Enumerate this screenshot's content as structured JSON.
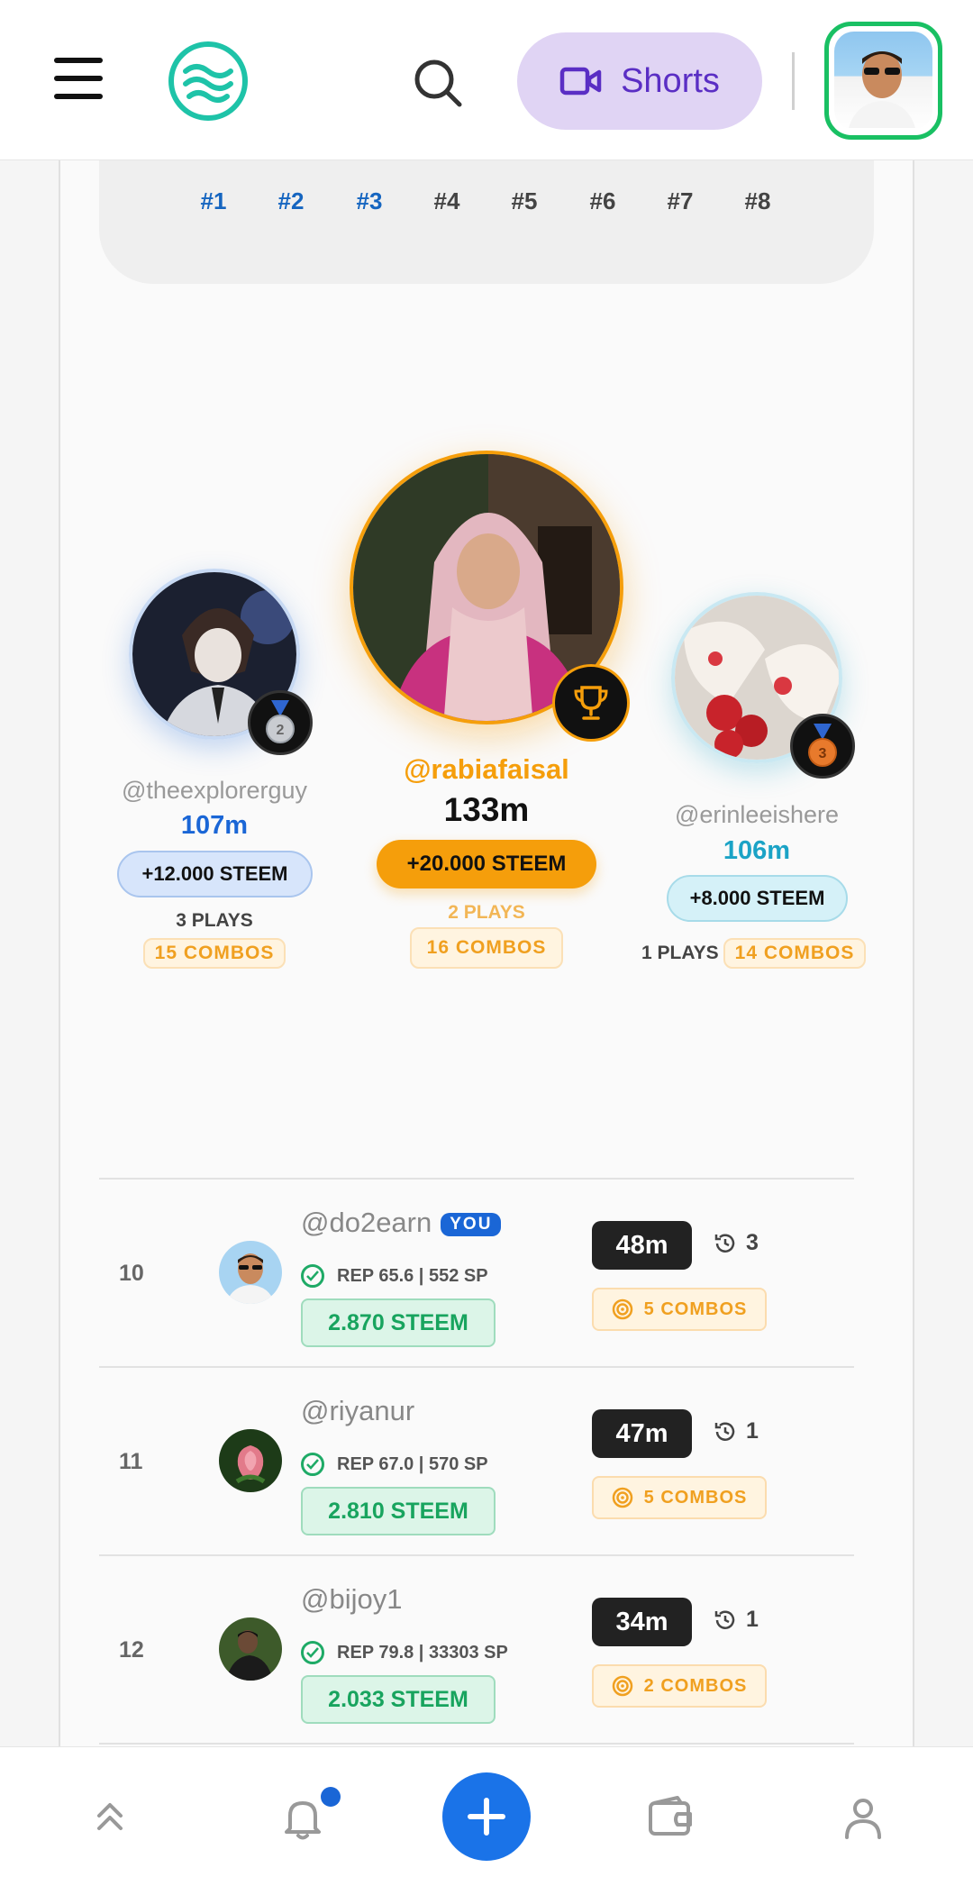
{
  "header": {
    "shorts_label": "Shorts"
  },
  "rounds": {
    "labels": [
      "#1",
      "#2",
      "#3",
      "#4",
      "#5",
      "#6",
      "#7",
      "#8"
    ]
  },
  "podium": {
    "first": {
      "username": "@rabiafaisal",
      "time": "133m",
      "reward": "+20.000 STEEM",
      "plays": "2 PLAYS",
      "combos": "16 COMBOS",
      "color": "#f59e0b"
    },
    "second": {
      "username": "@theexplorerguy",
      "time": "107m",
      "reward": "+12.000 STEEM",
      "plays": "3 PLAYS",
      "combos": "15 COMBOS",
      "color": "#1a66d6"
    },
    "third": {
      "username": "@erinleeishere",
      "time": "106m",
      "reward": "+8.000 STEEM",
      "plays": "1 PLAYS",
      "combos": "14 COMBOS",
      "color": "#1ba3c6"
    }
  },
  "leaderboard": [
    {
      "rank": "10",
      "username": "@do2earn",
      "you_badge": "YOU",
      "rep": "REP 65.6 | 552 SP",
      "steem": "2.870 STEEM",
      "time": "48m",
      "attempts": "3",
      "combos": "5 COMBOS"
    },
    {
      "rank": "11",
      "username": "@riyanur",
      "rep": "REP 67.0 | 570 SP",
      "steem": "2.810 STEEM",
      "time": "47m",
      "attempts": "1",
      "combos": "5 COMBOS"
    },
    {
      "rank": "12",
      "username": "@bijoy1",
      "rep": "REP 79.8 | 33303 SP",
      "steem": "2.033 STEEM",
      "time": "34m",
      "attempts": "1",
      "combos": "2 COMBOS"
    }
  ],
  "colors": {
    "accent": "#1a73e8",
    "gold": "#f59e0b",
    "green": "#18a45e"
  }
}
